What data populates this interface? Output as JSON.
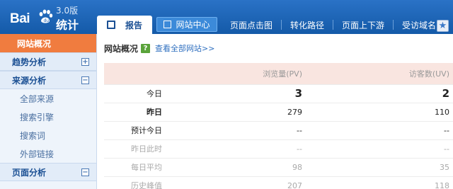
{
  "logo": {
    "text_bai": "Bai",
    "text_tongji": "统计",
    "version": "3.0版"
  },
  "nav": {
    "report_tab": "报告",
    "site_center": "网站中心",
    "links": [
      "页面点击图",
      "转化路径",
      "页面上下游",
      "受访域名"
    ]
  },
  "sidebar": {
    "active": "网站概况",
    "trend": "趋势分析",
    "source": "来源分析",
    "source_items": [
      "全部来源",
      "搜索引擎",
      "搜索词",
      "外部链接"
    ],
    "page": "页面分析"
  },
  "main": {
    "title": "网站概况",
    "help": "?",
    "view_all": "查看全部网站>>",
    "headers": {
      "pv": "浏览量(PV)",
      "uv": "访客数(UV)"
    },
    "rows": [
      {
        "label": "今日",
        "pv": "3",
        "uv": "2"
      },
      {
        "label": "昨日",
        "pv": "279",
        "uv": "110"
      },
      {
        "label": "预计今日",
        "pv": "--",
        "uv": "--"
      },
      {
        "label": "昨日此时",
        "pv": "--",
        "uv": "--"
      },
      {
        "label": "每日平均",
        "pv": "98",
        "uv": "35"
      },
      {
        "label": "历史峰值",
        "pv": "207",
        "uv": "118"
      }
    ]
  },
  "colors": {
    "topbar": "#1a5fb4",
    "active_sidebar": "#f07c3f",
    "table_header": "#f9e5e0",
    "link": "#2f6fbf"
  }
}
